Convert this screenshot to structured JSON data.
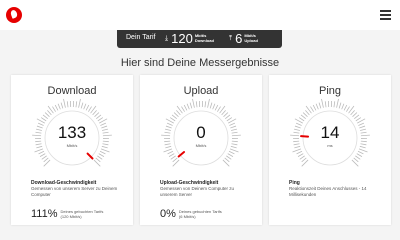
{
  "header": {
    "logo_icon": "vodafone-logo-icon",
    "menu_icon": "hamburger-menu-icon",
    "brand_color": "#e60000"
  },
  "tariff": {
    "label": "Dein Tarif",
    "download": {
      "value": "120",
      "unit_line1": "Mbit/s",
      "unit_line2": "Download",
      "icon": "download-icon"
    },
    "upload": {
      "value": "6",
      "unit_line1": "Mbit/s",
      "unit_line2": "Upload",
      "icon": "upload-icon"
    }
  },
  "results_heading": "Hier sind Deine Messergebnisse",
  "cards": [
    {
      "title": "Download",
      "value": "133",
      "unit": "Mbit/s",
      "gauge_fraction": 1.0,
      "detail_title": "Download-Geschwindigkeit",
      "detail_text": "Gemessen von unserem Server zu Deinem Computer",
      "percent": "111%",
      "percent_text_line1": "Deines gebuchten Tarifs",
      "percent_text_line2": "(120 Mbit/s)"
    },
    {
      "title": "Upload",
      "value": "0",
      "unit": "Mbit/s",
      "gauge_fraction": 0.02,
      "detail_title": "Upload-Geschwindigkeit",
      "detail_text": "Gemessen von Deinem Computer zu unserem Server",
      "percent": "0%",
      "percent_text_line1": "Deines gebuchten Tarifs",
      "percent_text_line2": "(6 Mbit/s)"
    },
    {
      "title": "Ping",
      "value": "14",
      "unit": "ms",
      "gauge_fraction": 0.18,
      "detail_title": "Ping",
      "detail_text": "Reaktionszeit Deines Anschlusses - 14 Millisekunden"
    }
  ]
}
